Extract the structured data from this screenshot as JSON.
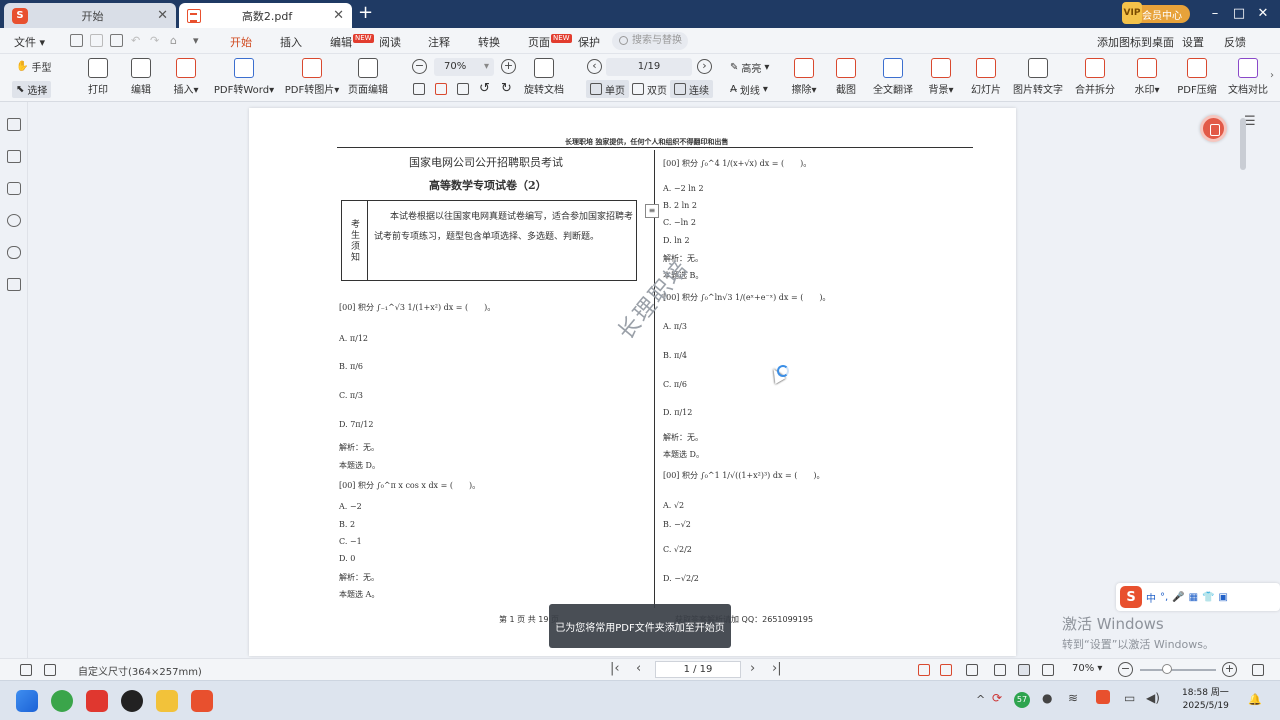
{
  "tabs": [
    {
      "label": "开始"
    },
    {
      "label": "高数2.pdf"
    }
  ],
  "titlebar": {
    "vip_label": "会员中心",
    "vip_badge": "VIP"
  },
  "menu": {
    "file": "文件",
    "items": [
      "开始",
      "插入",
      "编辑",
      "阅读",
      "注释",
      "转换",
      "页面",
      "保护"
    ],
    "new_tag": "NEW",
    "search_placeholder": "搜索与替换",
    "right": [
      "添加图标到桌面",
      "设置",
      "反馈"
    ]
  },
  "ribbon": {
    "hand": "手型",
    "select": "选择",
    "print": "打印",
    "edit": "编辑",
    "insert": "插入",
    "pdf_to_word": "PDF转Word",
    "pdf_to_img": "PDF转图片",
    "page_edit": "页面编辑",
    "zoom": "70%",
    "page_indicator": "1/19",
    "rotate": "旋转文档",
    "single": "单页",
    "double": "双页",
    "continuous": "连续",
    "highlight": "高亮",
    "strike": "划线",
    "erase": "擦除",
    "screenshot": "截图",
    "translate": "全文翻译",
    "background": "背景",
    "slideshow": "幻灯片",
    "img_to_text": "图片转文字",
    "merge_split": "合并拆分",
    "watermark": "水印",
    "compress": "PDF压缩",
    "compare": "文档对比"
  },
  "document": {
    "header_note": "长理职培 独家提供，任何个人和组织不得翻印和出售",
    "exam_title": "国家电网公司公开招聘职员考试",
    "paper_title": "高等数学专项试卷（2）",
    "notice_label": "考生须知",
    "notice_text": "本试卷根据以往国家电网真题试卷编写，适合参加国家招聘考试考前专项练习，题型包含单项选择、多选题、判断题。",
    "watermark": "长理职培",
    "left_questions": [
      {
        "stem": "[00] 积分 ∫₋₁^√3 1/(1+x²) dx = (　　)。",
        "options": [
          "A. π/12",
          "B. π/6",
          "C. π/3",
          "D. 7π/12"
        ],
        "analysis": "解析：无。",
        "answer": "本题选 D。"
      },
      {
        "stem": "[00] 积分 ∫₀^π x cos x dx = (　　)。",
        "options": [
          "A. −2",
          "B. 2",
          "C. −1",
          "D. 0"
        ],
        "analysis": "解析：无。",
        "answer": "本题选 A。"
      }
    ],
    "right_questions": [
      {
        "stem": "[00] 积分 ∫₀^4 1/(x+√x) dx = (　　)。",
        "options": [
          "A. −2 ln 2",
          "B. 2 ln 2",
          "C. −ln 2",
          "D. ln 2"
        ],
        "analysis": "解析：无。",
        "answer": "本题选 B。"
      },
      {
        "stem": "[00] 积分 ∫₀^ln√3 1/(eˣ+e⁻ˣ) dx = (　　)。",
        "options": [
          "A. π/3",
          "B. π/4",
          "C. π/6",
          "D. π/12"
        ],
        "analysis": "解析：无。",
        "answer": "本题选 D。"
      },
      {
        "stem": "[00] 积分 ∫₀^1 1/√((1+x²)³) dx = (　　)。",
        "options": [
          "A. √2",
          "B. −√2",
          "C. √2/2",
          "D. −√2/2"
        ]
      }
    ],
    "footer_left": "第 1 页 共 19 页",
    "footer_right": "获取答案解析请加 QQ：2651099195"
  },
  "toast": "已为您将常用PDF文件夹添加至开始页",
  "statusbar": {
    "page_size": "自定义尺寸(364×257mm)",
    "page": "1 / 19",
    "zoom": "70%"
  },
  "ime": {
    "lang": "中"
  },
  "activation": {
    "line1": "激活 Windows",
    "line2": "转到“设置”以激活 Windows。"
  },
  "taskbar": {
    "time": "18:58 周一",
    "date": "2025/5/19",
    "badge": "57"
  },
  "colors": {
    "accent": "#d04a1f",
    "titlebar": "#1f3a64",
    "vip": "#e7a23a"
  }
}
